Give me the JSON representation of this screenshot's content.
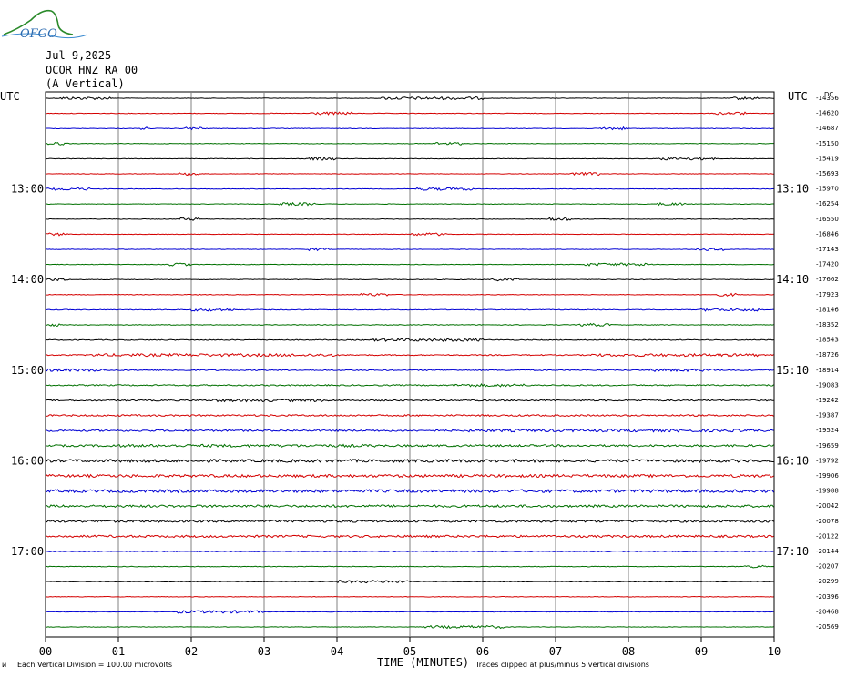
{
  "logo": {
    "text": "OFGO"
  },
  "header": {
    "date": "Jul 9,2025",
    "station": "OCOR HNZ RA 00",
    "component": "(A Vertical)"
  },
  "left_utc_label": "UTC",
  "right_utc_label": "UTC",
  "right_dc_label": "DC",
  "footer": {
    "corner_mark": "ᴎ",
    "scale_note": "Each Vertical Division =  100.00 microvolts",
    "xlabel": "TIME (MINUTES)",
    "clip_note": "Traces clipped at plus/minus 5 vertical divisions"
  },
  "colors": {
    "grid": "#808080",
    "traces": [
      "#000000",
      "#d40000",
      "#0000d4",
      "#007000"
    ]
  },
  "chart_data": {
    "type": "line",
    "title": "",
    "xlabel": "TIME (MINUTES)",
    "ylabel": "",
    "xlim": [
      0,
      10
    ],
    "x_ticks": [
      "00",
      "01",
      "02",
      "03",
      "04",
      "05",
      "06",
      "07",
      "08",
      "09",
      "10"
    ],
    "trace_count": 36,
    "left_time_labels": [
      {
        "row": 6,
        "label": "13:00"
      },
      {
        "row": 12,
        "label": "14:00"
      },
      {
        "row": 18,
        "label": "15:00"
      },
      {
        "row": 24,
        "label": "16:00"
      },
      {
        "row": 30,
        "label": "17:00"
      }
    ],
    "right_time_labels": [
      {
        "row": 6,
        "label": "13:10"
      },
      {
        "row": 12,
        "label": "14:10"
      },
      {
        "row": 18,
        "label": "15:10"
      },
      {
        "row": 24,
        "label": "16:10"
      },
      {
        "row": 30,
        "label": "17:10"
      }
    ],
    "dc_offsets": [
      "-14356",
      "-14620",
      "-14687",
      "-15150",
      "-15419",
      "-15693",
      "-15970",
      "-16254",
      "-16550",
      "-16846",
      "-17143",
      "-17420",
      "-17662",
      "-17923",
      "-18146",
      "-18352",
      "-18543",
      "-18726",
      "-18914",
      "-19083",
      "-19242",
      "-19387",
      "-19524",
      "-19659",
      "-19792",
      "-19906",
      "-19988",
      "-20042",
      "-20078",
      "-20122",
      "-20144",
      "-20207",
      "-20299",
      "-20396",
      "-20468",
      "-20569"
    ],
    "noise_level": [
      0.3,
      0.3,
      0.3,
      0.3,
      0.3,
      0.3,
      0.3,
      0.3,
      0.3,
      0.3,
      0.3,
      0.3,
      0.35,
      0.35,
      0.4,
      0.4,
      0.5,
      0.6,
      0.6,
      0.7,
      0.8,
      0.9,
      1.0,
      1.1,
      1.6,
      1.5,
      1.6,
      1.3,
      1.2,
      1.2,
      0.4,
      0.35,
      0.35,
      0.3,
      0.3,
      0.3
    ],
    "bursts": [
      [
        0,
        0.2,
        0.9
      ],
      [
        0,
        4.6,
        6.0
      ],
      [
        0,
        9.4,
        9.8
      ],
      [
        1,
        3.6,
        4.2
      ],
      [
        1,
        9.2,
        9.6
      ],
      [
        2,
        1.3,
        1.4
      ],
      [
        2,
        1.9,
        2.2
      ],
      [
        2,
        7.6,
        8.0
      ],
      [
        3,
        0.0,
        0.3
      ],
      [
        3,
        5.3,
        5.7
      ],
      [
        4,
        3.6,
        4.0
      ],
      [
        4,
        8.4,
        9.2
      ],
      [
        5,
        1.8,
        2.1
      ],
      [
        5,
        7.2,
        7.6
      ],
      [
        6,
        0.0,
        0.6
      ],
      [
        6,
        5.1,
        5.9
      ],
      [
        7,
        3.2,
        3.7
      ],
      [
        7,
        8.4,
        8.8
      ],
      [
        8,
        1.8,
        2.1
      ],
      [
        8,
        6.9,
        7.2
      ],
      [
        9,
        0.0,
        0.3
      ],
      [
        9,
        5.0,
        5.5
      ],
      [
        10,
        3.6,
        3.9
      ],
      [
        10,
        8.9,
        9.3
      ],
      [
        11,
        1.7,
        2.0
      ],
      [
        11,
        7.4,
        8.4
      ],
      [
        12,
        0.0,
        0.3
      ],
      [
        12,
        6.1,
        6.5
      ],
      [
        13,
        4.3,
        4.7
      ],
      [
        13,
        9.2,
        9.5
      ],
      [
        14,
        2.0,
        2.6
      ],
      [
        14,
        9.0,
        9.8
      ],
      [
        15,
        0.0,
        0.2
      ],
      [
        15,
        7.3,
        7.8
      ],
      [
        16,
        4.5,
        6.0
      ],
      [
        17,
        0.6,
        4.0
      ],
      [
        17,
        7.5,
        9.8
      ],
      [
        18,
        0.0,
        0.8
      ],
      [
        18,
        8.3,
        9.2
      ],
      [
        19,
        5.6,
        6.6
      ],
      [
        20,
        2.3,
        3.8
      ],
      [
        22,
        5.8,
        9.8
      ],
      [
        23,
        0.8,
        4.6
      ],
      [
        31,
        9.6,
        9.9
      ],
      [
        32,
        4.0,
        5.0
      ],
      [
        34,
        1.8,
        3.0
      ],
      [
        35,
        5.2,
        6.3
      ]
    ]
  }
}
